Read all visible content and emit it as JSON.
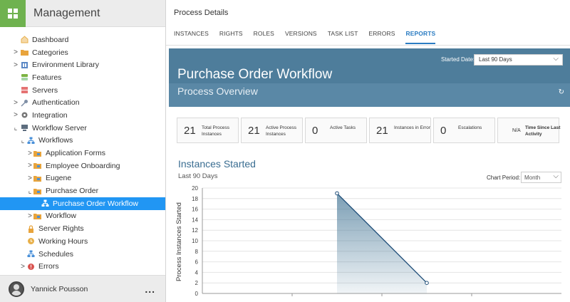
{
  "sidebar": {
    "title": "Management",
    "items": [
      {
        "label": "Dashboard",
        "level": 0,
        "expander": "",
        "icon": "dashboard-icon",
        "color": "#e8b04a"
      },
      {
        "label": "Categories",
        "level": 0,
        "expander": ">",
        "icon": "folder-icon",
        "color": "#e8a43c"
      },
      {
        "label": "Environment Library",
        "level": 0,
        "expander": ">",
        "icon": "library-icon",
        "color": "#5a87c5"
      },
      {
        "label": "Features",
        "level": 0,
        "expander": "",
        "icon": "features-icon",
        "color": "#7cb342"
      },
      {
        "label": "Servers",
        "level": 0,
        "expander": "",
        "icon": "server-icon",
        "color": "#e57373"
      },
      {
        "label": "Authentication",
        "level": 0,
        "expander": ">",
        "icon": "key-icon",
        "color": "#7f8fa6"
      },
      {
        "label": "Integration",
        "level": 0,
        "expander": ">",
        "icon": "gear-icon",
        "color": "#777777"
      },
      {
        "label": "Workflow Server",
        "level": 0,
        "expander": "⌞",
        "icon": "workflow-server-icon",
        "color": "#5d6d7e"
      },
      {
        "label": "Workflows",
        "level": 1,
        "expander": "⌞",
        "icon": "workflows-icon",
        "color": "#4a90d9"
      },
      {
        "label": "Application Forms",
        "level": 2,
        "expander": ">",
        "icon": "folder-workflow-icon",
        "color": "#e8a43c"
      },
      {
        "label": "Employee Onboarding",
        "level": 2,
        "expander": ">",
        "icon": "folder-workflow-icon",
        "color": "#e8a43c"
      },
      {
        "label": "Eugene",
        "level": 2,
        "expander": ">",
        "icon": "folder-workflow-icon",
        "color": "#e8a43c"
      },
      {
        "label": "Purchase Order",
        "level": 2,
        "expander": "⌞",
        "icon": "folder-workflow-icon",
        "color": "#e8a43c"
      },
      {
        "label": "Purchase Order Workflow",
        "level": 3,
        "expander": "",
        "icon": "workflow-icon",
        "color": "#ffffff",
        "selected": true
      },
      {
        "label": "Workflow",
        "level": 2,
        "expander": ">",
        "icon": "folder-workflow-icon",
        "color": "#e8a43c"
      },
      {
        "label": "Server Rights",
        "level": 1,
        "expander": "",
        "icon": "lock-icon",
        "color": "#e8a43c"
      },
      {
        "label": "Working Hours",
        "level": 1,
        "expander": "",
        "icon": "clock-icon",
        "color": "#e8b04a"
      },
      {
        "label": "Schedules",
        "level": 1,
        "expander": "",
        "icon": "schedule-icon",
        "color": "#4a90d9"
      },
      {
        "label": "Errors",
        "level": 1,
        "expander": ">",
        "icon": "error-icon",
        "color": "#d9534f"
      }
    ],
    "user": "Yannick Pousson",
    "more": "..."
  },
  "main": {
    "title": "Process Details",
    "tabs": [
      {
        "label": "INSTANCES",
        "active": false
      },
      {
        "label": "RIGHTS",
        "active": false
      },
      {
        "label": "ROLES",
        "active": false
      },
      {
        "label": "VERSIONS",
        "active": false
      },
      {
        "label": "TASK LIST",
        "active": false
      },
      {
        "label": "ERRORS",
        "active": false
      },
      {
        "label": "REPORTS",
        "active": true
      }
    ],
    "banner": {
      "title": "Purchase Order Workflow",
      "subtitle": "Process Overview",
      "started_label": "Started Date:",
      "started_value": "Last 90 Days",
      "color": "#4e7d9b"
    },
    "stats": [
      {
        "value": "21",
        "label": "Total Process Instances"
      },
      {
        "value": "21",
        "label": "Active Process Instances"
      },
      {
        "value": "0",
        "label": "Active Tasks"
      },
      {
        "value": "21",
        "label": "Instances in Error"
      },
      {
        "value": "0",
        "label": "Escalations"
      },
      {
        "value": "N/A",
        "label": "Time Since Last Activity"
      }
    ],
    "chart_header": {
      "title": "Instances Started",
      "subtitle": "Last 90 Days",
      "period_label": "Chart Period:",
      "period_value": "Month"
    }
  },
  "chart_data": {
    "type": "area",
    "x": [
      "",
      "",
      "",
      ""
    ],
    "values": [
      null,
      19,
      2,
      null
    ],
    "ylabel": "Process Instances Started",
    "ylim": [
      0,
      20
    ],
    "yticks": [
      0,
      2,
      4,
      6,
      8,
      10,
      12,
      14,
      16,
      18,
      20
    ],
    "grid": true,
    "line_color": "#1f4e79",
    "fill_color": "#4e7d9b"
  }
}
